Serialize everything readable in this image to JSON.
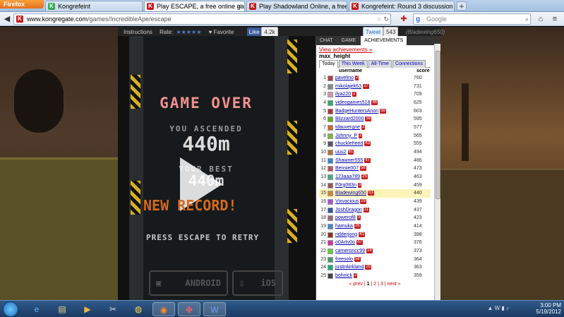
{
  "browser": {
    "menu_label": "Firefox",
    "tabs": [
      {
        "title": "Kongrefeint",
        "favicon": "K",
        "color": "#33aa55"
      },
      {
        "title": "Play ESCAPE, a free online game on K...",
        "favicon": "K",
        "color": "#c61b1b",
        "active": true
      },
      {
        "title": "Play Shadowland Online, a free online...",
        "favicon": "K",
        "color": "#c61b1b"
      },
      {
        "title": "Kongrefeint: Round 3 discussion on K...",
        "favicon": "K",
        "color": "#c61b1b"
      }
    ],
    "new_tab_symbol": "+",
    "url_host": "www.kongregate.com",
    "url_path": "/games/IncredibleApe/escape",
    "search_placeholder": "Google",
    "search_engine_glyph": "g"
  },
  "game_meta": {
    "instructions": "Instructions",
    "rate_label": "Rate:",
    "favorite": "Favorite",
    "like": "Like",
    "like_count": "4.2k",
    "tweet": "Tweet",
    "tweet_count": "543",
    "user": "(Bladewing650)"
  },
  "game": {
    "title": "GAME OVER",
    "ascended_label": "YOU ASCENDED",
    "ascended_value": "440m",
    "best_label": "YOUR BEST",
    "best_value": "440m",
    "record": "NEW RECORD!",
    "retry": "PRESS ESCAPE TO RETRY",
    "android": "ANDROID",
    "ios": "iOS"
  },
  "panel": {
    "tabs": [
      "CHAT",
      "GAME",
      "ACHIEVEMENTS"
    ],
    "active_tab": 2,
    "view_link": "View achievements »",
    "stat_name": "max_height",
    "range_tabs": [
      "Today",
      "This Week",
      "All-Time",
      "Connections"
    ],
    "col_user": "username",
    "col_score": "score",
    "rows": [
      {
        "rank": "1",
        "name": "pavelino",
        "level": "2",
        "score": "760"
      },
      {
        "rank": "2",
        "name": "mikolajek63",
        "level": "27",
        "score": "731"
      },
      {
        "rank": "3",
        "name": "ilya220",
        "level": "2",
        "score": "709"
      },
      {
        "rank": "4",
        "name": "videogames518",
        "level": "46",
        "score": "625"
      },
      {
        "rank": "5",
        "name": "BadgeHuntersAnon",
        "level": "38",
        "score": "603"
      },
      {
        "rank": "6",
        "name": "Blizzard2000",
        "level": "59",
        "score": "595"
      },
      {
        "rank": "7",
        "name": "tdauvergne",
        "level": "2",
        "score": "577"
      },
      {
        "rank": "8",
        "name": "Johnny_P",
        "level": "2",
        "score": "565"
      },
      {
        "rank": "9",
        "name": "chuckleheed",
        "level": "43",
        "score": "555"
      },
      {
        "rank": "10",
        "name": "uuu2",
        "level": "61",
        "score": "494"
      },
      {
        "rank": "11",
        "name": "Shawner555",
        "level": "47",
        "score": "486"
      },
      {
        "rank": "12",
        "name": "Bensie007",
        "level": "58",
        "score": "473"
      },
      {
        "rank": "13",
        "name": "123aaa789",
        "level": "25",
        "score": "463"
      },
      {
        "rank": "14",
        "name": "F0rg0tt3n",
        "level": "3",
        "score": "459"
      },
      {
        "rank": "15",
        "name": "Bladewing650",
        "level": "53",
        "score": "440",
        "highlight": true
      },
      {
        "rank": "16",
        "name": "Vixvacious",
        "level": "29",
        "score": "439"
      },
      {
        "rank": "17",
        "name": "JoshDragon",
        "level": "11",
        "score": "437"
      },
      {
        "rank": "18",
        "name": "powerof8",
        "level": "3",
        "score": "423"
      },
      {
        "rank": "19",
        "name": "hamuka",
        "level": "26",
        "score": "414"
      },
      {
        "rank": "20",
        "name": "ridderjong",
        "level": "41",
        "score": "398"
      },
      {
        "rank": "21",
        "name": "o0Artv0o",
        "level": "47",
        "score": "376"
      },
      {
        "rank": "22",
        "name": "cameroncc99",
        "level": "14",
        "score": "373"
      },
      {
        "rank": "23",
        "name": "freesolo",
        "level": "58",
        "score": "364"
      },
      {
        "rank": "24",
        "name": "justinkirkland",
        "level": "20",
        "score": "363"
      },
      {
        "rank": "25",
        "name": "bohnick",
        "level": "2",
        "score": "359"
      }
    ],
    "pager": {
      "prev": "« prev",
      "p1": "1",
      "p2": "2",
      "p3": "3",
      "next": "next »"
    }
  },
  "taskbar": {
    "time": "3:00 PM",
    "date": "5/19/2012"
  }
}
